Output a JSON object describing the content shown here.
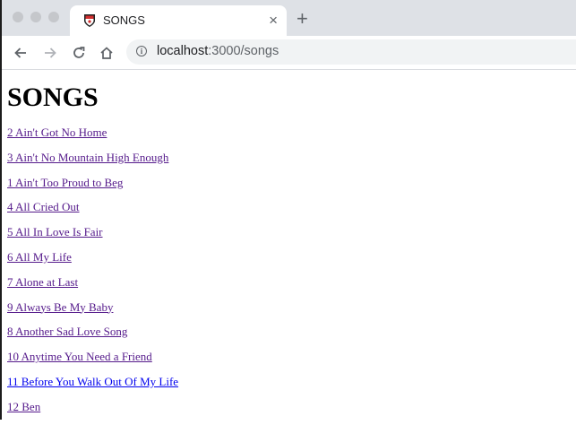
{
  "browser": {
    "tab_title": "SONGS",
    "tab_close": "×",
    "new_tab": "+",
    "url_host": "localhost",
    "url_path": ":3000/songs"
  },
  "page": {
    "heading": "SONGS",
    "songs": [
      {
        "text": "2 Ain't Got No Home",
        "visited": true
      },
      {
        "text": "3 Ain't No Mountain High Enough",
        "visited": true
      },
      {
        "text": "1 Ain't Too Proud to Beg",
        "visited": true
      },
      {
        "text": "4 All Cried Out",
        "visited": true
      },
      {
        "text": "5 All In Love Is Fair",
        "visited": true
      },
      {
        "text": "6 All My Life",
        "visited": true
      },
      {
        "text": "7 Alone at Last",
        "visited": true
      },
      {
        "text": "9 Always Be My Baby",
        "visited": true
      },
      {
        "text": "8 Another Sad Love Song",
        "visited": true
      },
      {
        "text": "10 Anytime You Need a Friend",
        "visited": true
      },
      {
        "text": "11 Before You Walk Out Of My Life",
        "visited": false
      },
      {
        "text": "12 Ben",
        "visited": true
      }
    ]
  },
  "colors": {
    "visited_link": "#551a8b",
    "unvisited_link": "#0000ee",
    "tabbar": "#dee1e6"
  },
  "icons": [
    "back-arrow-icon",
    "forward-arrow-icon",
    "reload-icon",
    "home-icon",
    "info-icon",
    "favicon-shield-icon"
  ]
}
